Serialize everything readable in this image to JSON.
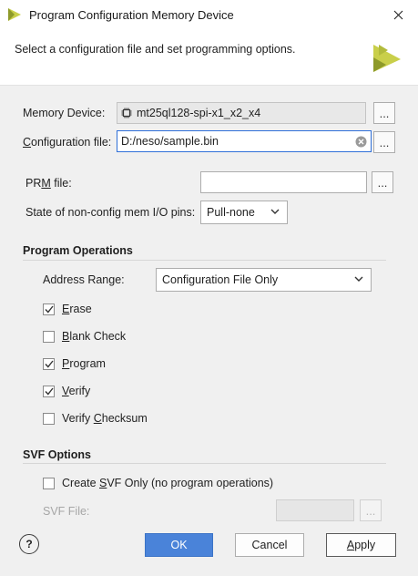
{
  "window": {
    "title": "Program Configuration Memory Device"
  },
  "header": {
    "description": "Select a configuration file and set programming options."
  },
  "memory_device": {
    "label": "Memory Device:",
    "value": "mt25ql128-spi-x1_x2_x4",
    "browse": "..."
  },
  "config_file": {
    "label": "Configuration file:",
    "value": "D:/neso/sample.bin",
    "browse": "..."
  },
  "prm_file": {
    "label": "PRM file:",
    "value": "",
    "browse": "..."
  },
  "non_config_pins": {
    "label": "State of non-config mem I/O pins:",
    "value": "Pull-none"
  },
  "program_operations": {
    "title": "Program Operations",
    "address_range": {
      "label": "Address Range:",
      "value": "Configuration File Only"
    },
    "options": [
      {
        "label": "Erase",
        "checked": true
      },
      {
        "label": "Blank Check",
        "checked": false
      },
      {
        "label": "Program",
        "checked": true
      },
      {
        "label": "Verify",
        "checked": true
      },
      {
        "label": "Verify Checksum",
        "checked": false
      }
    ]
  },
  "svf_options": {
    "title": "SVF Options",
    "create_svf_only": {
      "label": "Create SVF Only (no program operations)",
      "checked": false
    },
    "svf_file": {
      "label": "SVF File:",
      "value": "",
      "browse": "..."
    }
  },
  "footer": {
    "help": "?",
    "ok": "OK",
    "cancel": "Cancel",
    "apply": "Apply"
  },
  "colors": {
    "accent": "#4a83d9",
    "focus": "#2f6fd8",
    "logo": "#a8b23a"
  }
}
